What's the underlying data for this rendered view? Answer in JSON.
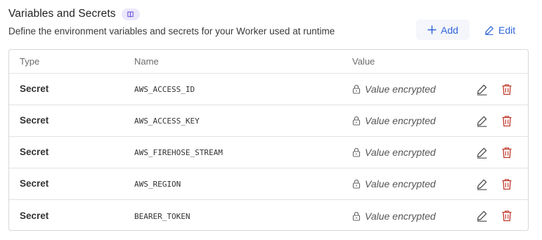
{
  "header": {
    "title": "Variables and Secrets",
    "subtitle": "Define the environment variables and secrets for your Worker used at runtime"
  },
  "actions": {
    "add_label": "Add",
    "edit_label": "Edit"
  },
  "table": {
    "columns": [
      "Type",
      "Name",
      "Value"
    ],
    "rows": [
      {
        "type": "Secret",
        "name": "AWS_ACCESS_ID",
        "value": "Value encrypted"
      },
      {
        "type": "Secret",
        "name": "AWS_ACCESS_KEY",
        "value": "Value encrypted"
      },
      {
        "type": "Secret",
        "name": "AWS_FIREHOSE_STREAM",
        "value": "Value encrypted"
      },
      {
        "type": "Secret",
        "name": "AWS_REGION",
        "value": "Value encrypted"
      },
      {
        "type": "Secret",
        "name": "BEARER_TOKEN",
        "value": "Value encrypted"
      }
    ]
  },
  "icons": {
    "doc": "book-icon",
    "add": "plus-icon",
    "edit": "pencil-icon",
    "lock": "lock-icon",
    "delete": "trash-icon"
  },
  "colors": {
    "accent": "#2f63d6",
    "danger": "#c0392b",
    "badge_bg": "#ece8fb"
  }
}
